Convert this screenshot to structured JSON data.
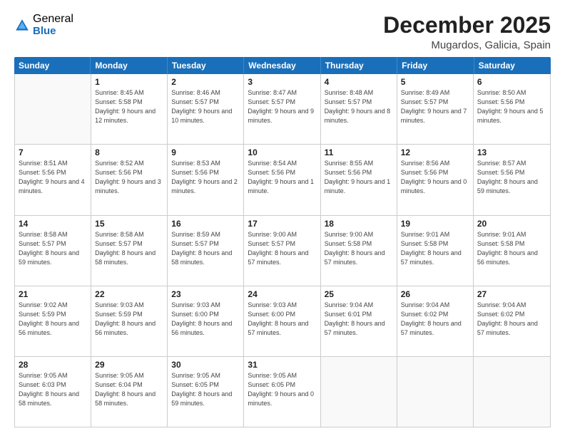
{
  "logo": {
    "general": "General",
    "blue": "Blue"
  },
  "title": {
    "month": "December 2025",
    "location": "Mugardos, Galicia, Spain"
  },
  "header_days": [
    "Sunday",
    "Monday",
    "Tuesday",
    "Wednesday",
    "Thursday",
    "Friday",
    "Saturday"
  ],
  "weeks": [
    [
      {
        "day": "",
        "empty": true
      },
      {
        "day": "1",
        "sunrise": "Sunrise: 8:45 AM",
        "sunset": "Sunset: 5:58 PM",
        "daylight": "Daylight: 9 hours and 12 minutes."
      },
      {
        "day": "2",
        "sunrise": "Sunrise: 8:46 AM",
        "sunset": "Sunset: 5:57 PM",
        "daylight": "Daylight: 9 hours and 10 minutes."
      },
      {
        "day": "3",
        "sunrise": "Sunrise: 8:47 AM",
        "sunset": "Sunset: 5:57 PM",
        "daylight": "Daylight: 9 hours and 9 minutes."
      },
      {
        "day": "4",
        "sunrise": "Sunrise: 8:48 AM",
        "sunset": "Sunset: 5:57 PM",
        "daylight": "Daylight: 9 hours and 8 minutes."
      },
      {
        "day": "5",
        "sunrise": "Sunrise: 8:49 AM",
        "sunset": "Sunset: 5:57 PM",
        "daylight": "Daylight: 9 hours and 7 minutes."
      },
      {
        "day": "6",
        "sunrise": "Sunrise: 8:50 AM",
        "sunset": "Sunset: 5:56 PM",
        "daylight": "Daylight: 9 hours and 5 minutes."
      }
    ],
    [
      {
        "day": "7",
        "sunrise": "Sunrise: 8:51 AM",
        "sunset": "Sunset: 5:56 PM",
        "daylight": "Daylight: 9 hours and 4 minutes."
      },
      {
        "day": "8",
        "sunrise": "Sunrise: 8:52 AM",
        "sunset": "Sunset: 5:56 PM",
        "daylight": "Daylight: 9 hours and 3 minutes."
      },
      {
        "day": "9",
        "sunrise": "Sunrise: 8:53 AM",
        "sunset": "Sunset: 5:56 PM",
        "daylight": "Daylight: 9 hours and 2 minutes."
      },
      {
        "day": "10",
        "sunrise": "Sunrise: 8:54 AM",
        "sunset": "Sunset: 5:56 PM",
        "daylight": "Daylight: 9 hours and 1 minute."
      },
      {
        "day": "11",
        "sunrise": "Sunrise: 8:55 AM",
        "sunset": "Sunset: 5:56 PM",
        "daylight": "Daylight: 9 hours and 1 minute."
      },
      {
        "day": "12",
        "sunrise": "Sunrise: 8:56 AM",
        "sunset": "Sunset: 5:56 PM",
        "daylight": "Daylight: 9 hours and 0 minutes."
      },
      {
        "day": "13",
        "sunrise": "Sunrise: 8:57 AM",
        "sunset": "Sunset: 5:56 PM",
        "daylight": "Daylight: 8 hours and 59 minutes."
      }
    ],
    [
      {
        "day": "14",
        "sunrise": "Sunrise: 8:58 AM",
        "sunset": "Sunset: 5:57 PM",
        "daylight": "Daylight: 8 hours and 59 minutes."
      },
      {
        "day": "15",
        "sunrise": "Sunrise: 8:58 AM",
        "sunset": "Sunset: 5:57 PM",
        "daylight": "Daylight: 8 hours and 58 minutes."
      },
      {
        "day": "16",
        "sunrise": "Sunrise: 8:59 AM",
        "sunset": "Sunset: 5:57 PM",
        "daylight": "Daylight: 8 hours and 58 minutes."
      },
      {
        "day": "17",
        "sunrise": "Sunrise: 9:00 AM",
        "sunset": "Sunset: 5:57 PM",
        "daylight": "Daylight: 8 hours and 57 minutes."
      },
      {
        "day": "18",
        "sunrise": "Sunrise: 9:00 AM",
        "sunset": "Sunset: 5:58 PM",
        "daylight": "Daylight: 8 hours and 57 minutes."
      },
      {
        "day": "19",
        "sunrise": "Sunrise: 9:01 AM",
        "sunset": "Sunset: 5:58 PM",
        "daylight": "Daylight: 8 hours and 57 minutes."
      },
      {
        "day": "20",
        "sunrise": "Sunrise: 9:01 AM",
        "sunset": "Sunset: 5:58 PM",
        "daylight": "Daylight: 8 hours and 56 minutes."
      }
    ],
    [
      {
        "day": "21",
        "sunrise": "Sunrise: 9:02 AM",
        "sunset": "Sunset: 5:59 PM",
        "daylight": "Daylight: 8 hours and 56 minutes."
      },
      {
        "day": "22",
        "sunrise": "Sunrise: 9:03 AM",
        "sunset": "Sunset: 5:59 PM",
        "daylight": "Daylight: 8 hours and 56 minutes."
      },
      {
        "day": "23",
        "sunrise": "Sunrise: 9:03 AM",
        "sunset": "Sunset: 6:00 PM",
        "daylight": "Daylight: 8 hours and 56 minutes."
      },
      {
        "day": "24",
        "sunrise": "Sunrise: 9:03 AM",
        "sunset": "Sunset: 6:00 PM",
        "daylight": "Daylight: 8 hours and 57 minutes."
      },
      {
        "day": "25",
        "sunrise": "Sunrise: 9:04 AM",
        "sunset": "Sunset: 6:01 PM",
        "daylight": "Daylight: 8 hours and 57 minutes."
      },
      {
        "day": "26",
        "sunrise": "Sunrise: 9:04 AM",
        "sunset": "Sunset: 6:02 PM",
        "daylight": "Daylight: 8 hours and 57 minutes."
      },
      {
        "day": "27",
        "sunrise": "Sunrise: 9:04 AM",
        "sunset": "Sunset: 6:02 PM",
        "daylight": "Daylight: 8 hours and 57 minutes."
      }
    ],
    [
      {
        "day": "28",
        "sunrise": "Sunrise: 9:05 AM",
        "sunset": "Sunset: 6:03 PM",
        "daylight": "Daylight: 8 hours and 58 minutes."
      },
      {
        "day": "29",
        "sunrise": "Sunrise: 9:05 AM",
        "sunset": "Sunset: 6:04 PM",
        "daylight": "Daylight: 8 hours and 58 minutes."
      },
      {
        "day": "30",
        "sunrise": "Sunrise: 9:05 AM",
        "sunset": "Sunset: 6:05 PM",
        "daylight": "Daylight: 8 hours and 59 minutes."
      },
      {
        "day": "31",
        "sunrise": "Sunrise: 9:05 AM",
        "sunset": "Sunset: 6:05 PM",
        "daylight": "Daylight: 9 hours and 0 minutes."
      },
      {
        "day": "",
        "empty": true
      },
      {
        "day": "",
        "empty": true
      },
      {
        "day": "",
        "empty": true
      }
    ]
  ]
}
